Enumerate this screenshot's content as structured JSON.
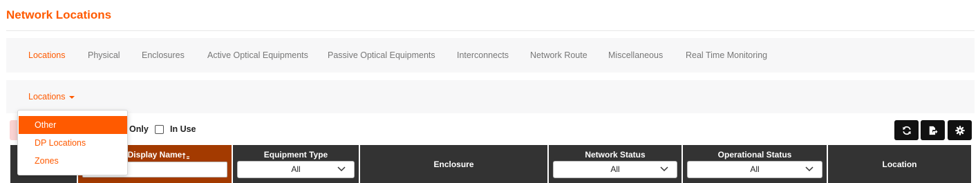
{
  "page": {
    "title": "Network Locations"
  },
  "tabs": [
    {
      "label": "Locations",
      "active": true
    },
    {
      "label": "Physical"
    },
    {
      "label": "Enclosures"
    },
    {
      "label": "Active Optical Equipments"
    },
    {
      "label": "Passive Optical Equipments"
    },
    {
      "label": "Interconnects"
    },
    {
      "label": "Network Route"
    },
    {
      "label": "Miscellaneous"
    },
    {
      "label": "Real Time Monitoring"
    }
  ],
  "subnav": {
    "dropdown_label": "Locations"
  },
  "dropdown_menu": {
    "items": [
      {
        "label": "Other",
        "active": true
      },
      {
        "label": "DP Locations"
      },
      {
        "label": "Zones"
      }
    ]
  },
  "filters": {
    "only_label": "Only",
    "in_use_label": "In Use"
  },
  "toolbar": {
    "icons": [
      "refresh-icon",
      "export-icon",
      "settings-icon"
    ]
  },
  "table": {
    "columns": {
      "display_name": "Display Name",
      "equipment_type": {
        "label": "Equipment Type",
        "value": "All"
      },
      "enclosure": "Enclosure",
      "network_status": {
        "label": "Network Status",
        "value": "All"
      },
      "operational_status": {
        "label": "Operational Status",
        "value": "All"
      },
      "location": "Location"
    }
  },
  "colors": {
    "accent": "#ff5a00",
    "header_bg": "#333333",
    "sorted_header_bg": "#a33a00"
  }
}
